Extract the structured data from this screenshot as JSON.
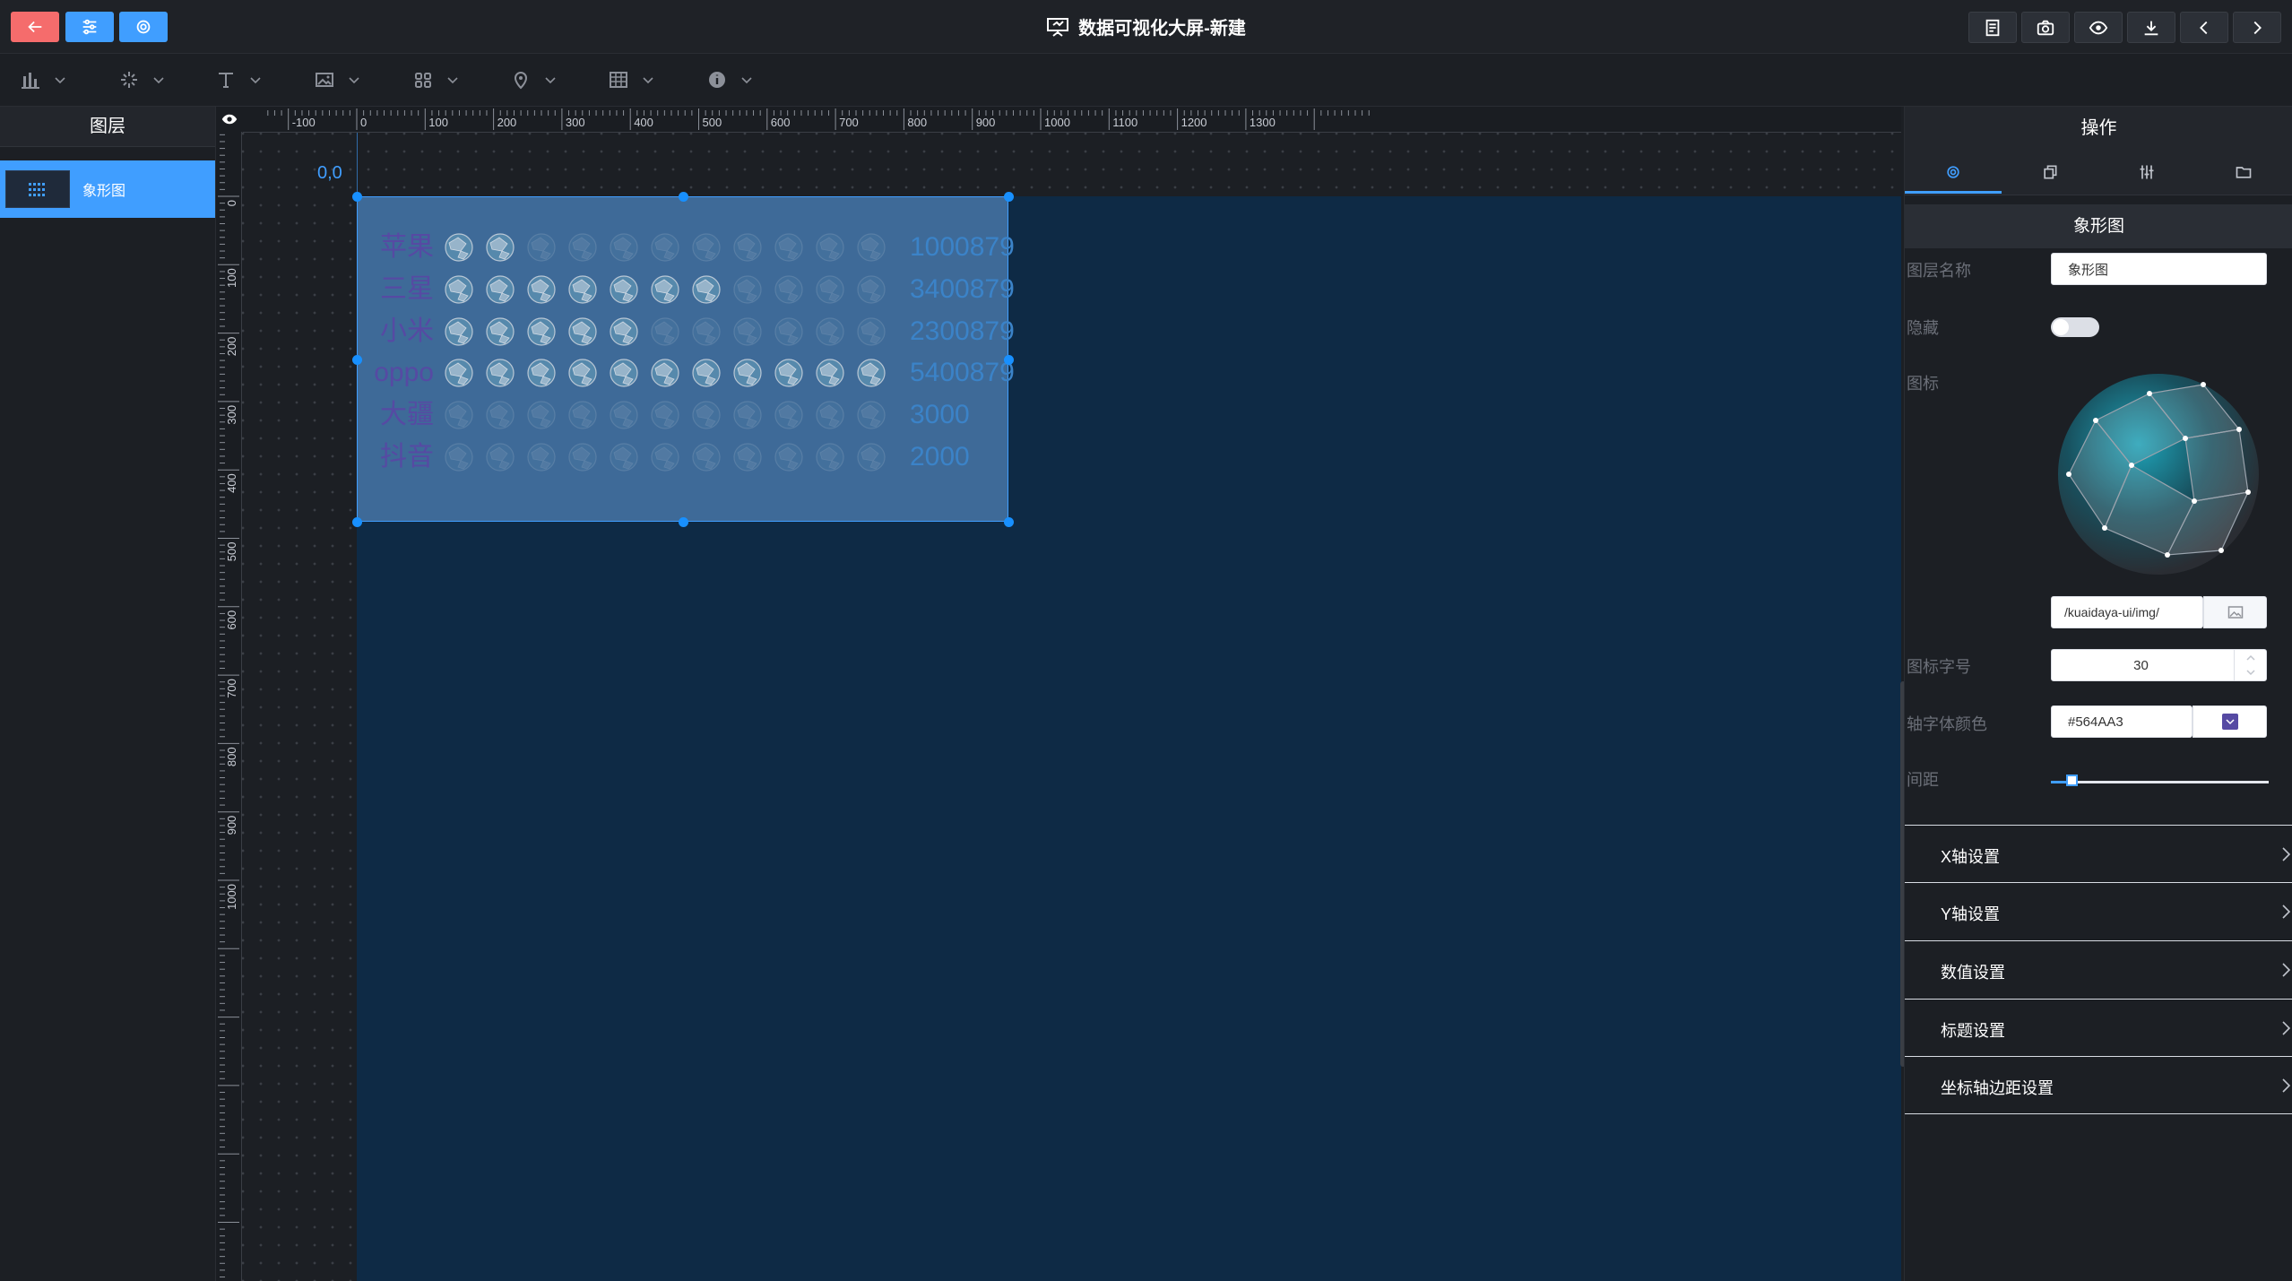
{
  "app": {
    "title": "数据可视化大屏-新建"
  },
  "colors": {
    "back_button": "#f56c6c",
    "blue_button": "#409eff",
    "screen_bg": "#0e2a45",
    "selection": "#409eff",
    "axis_font": "#564AA3"
  },
  "header": {
    "left_buttons": [
      {
        "name": "back-button",
        "icon": "arrow-left-icon"
      },
      {
        "name": "settings-sliders-button",
        "icon": "sliders-icon"
      },
      {
        "name": "gear-button",
        "icon": "gear-icon"
      }
    ],
    "right_buttons": [
      {
        "name": "notes-button",
        "icon": "document-icon"
      },
      {
        "name": "screenshot-button",
        "icon": "camera-icon"
      },
      {
        "name": "preview-button",
        "icon": "eye-icon"
      },
      {
        "name": "download-button",
        "icon": "download-icon"
      },
      {
        "name": "undo-button",
        "icon": "chevron-left-icon"
      },
      {
        "name": "redo-button",
        "icon": "chevron-right-icon"
      }
    ]
  },
  "toolbar": {
    "tools": [
      {
        "name": "chart-tool",
        "icon": "bar-chart-icon"
      },
      {
        "name": "effect-tool",
        "icon": "sparkle-icon"
      },
      {
        "name": "text-tool",
        "icon": "text-icon"
      },
      {
        "name": "image-tool",
        "icon": "image-icon"
      },
      {
        "name": "widget-tool",
        "icon": "grid-icon"
      },
      {
        "name": "map-tool",
        "icon": "map-pin-icon"
      },
      {
        "name": "table-tool",
        "icon": "table-icon"
      },
      {
        "name": "info-tool",
        "icon": "info-icon"
      }
    ]
  },
  "layers": {
    "title": "图层",
    "items": [
      {
        "label": "象形图",
        "selected": true
      }
    ]
  },
  "canvas": {
    "origin_label": "0,0",
    "ruler_h_labels": [
      "-100",
      "0",
      "100",
      "200",
      "300",
      "400",
      "500",
      "600",
      "700",
      "800",
      "900",
      "1000",
      "1100",
      "1200",
      "1300"
    ],
    "ruler_v_labels": [
      "0",
      "100",
      "200",
      "300",
      "400",
      "500",
      "600",
      "700",
      "800",
      "900",
      "1000"
    ]
  },
  "chart_data": {
    "type": "pictorial-bar",
    "categories": [
      "苹果",
      "三星",
      "小米",
      "oppo",
      "大疆",
      "抖音"
    ],
    "value_labels": [
      "1000879",
      "3400879",
      "2300879",
      "5400879",
      "3000",
      "2000"
    ],
    "icons_filled": [
      2,
      7,
      5,
      11,
      0,
      0
    ],
    "icons_total": 11
  },
  "right_panel": {
    "header": "操作",
    "tabs": [
      "config-icon",
      "copy-icon",
      "sliders-icon",
      "folder-icon"
    ],
    "active_tab": 0,
    "section_title": "象形图",
    "fields": {
      "layer_name_label": "图层名称",
      "layer_name_value": "象形图",
      "hidden_label": "隐藏",
      "hidden_value": false,
      "icon_label": "图标",
      "icon_url": "/kuaidaya-ui/img/",
      "icon_font_size_label": "图标字号",
      "icon_font_size_value": "30",
      "axis_font_color_label": "轴字体颜色",
      "axis_font_color_value": "#564AA3",
      "spacing_label": "间距",
      "spacing_value": 0.1
    },
    "collapsibles": [
      "X轴设置",
      "Y轴设置",
      "数值设置",
      "标题设置",
      "坐标轴边距设置"
    ]
  }
}
